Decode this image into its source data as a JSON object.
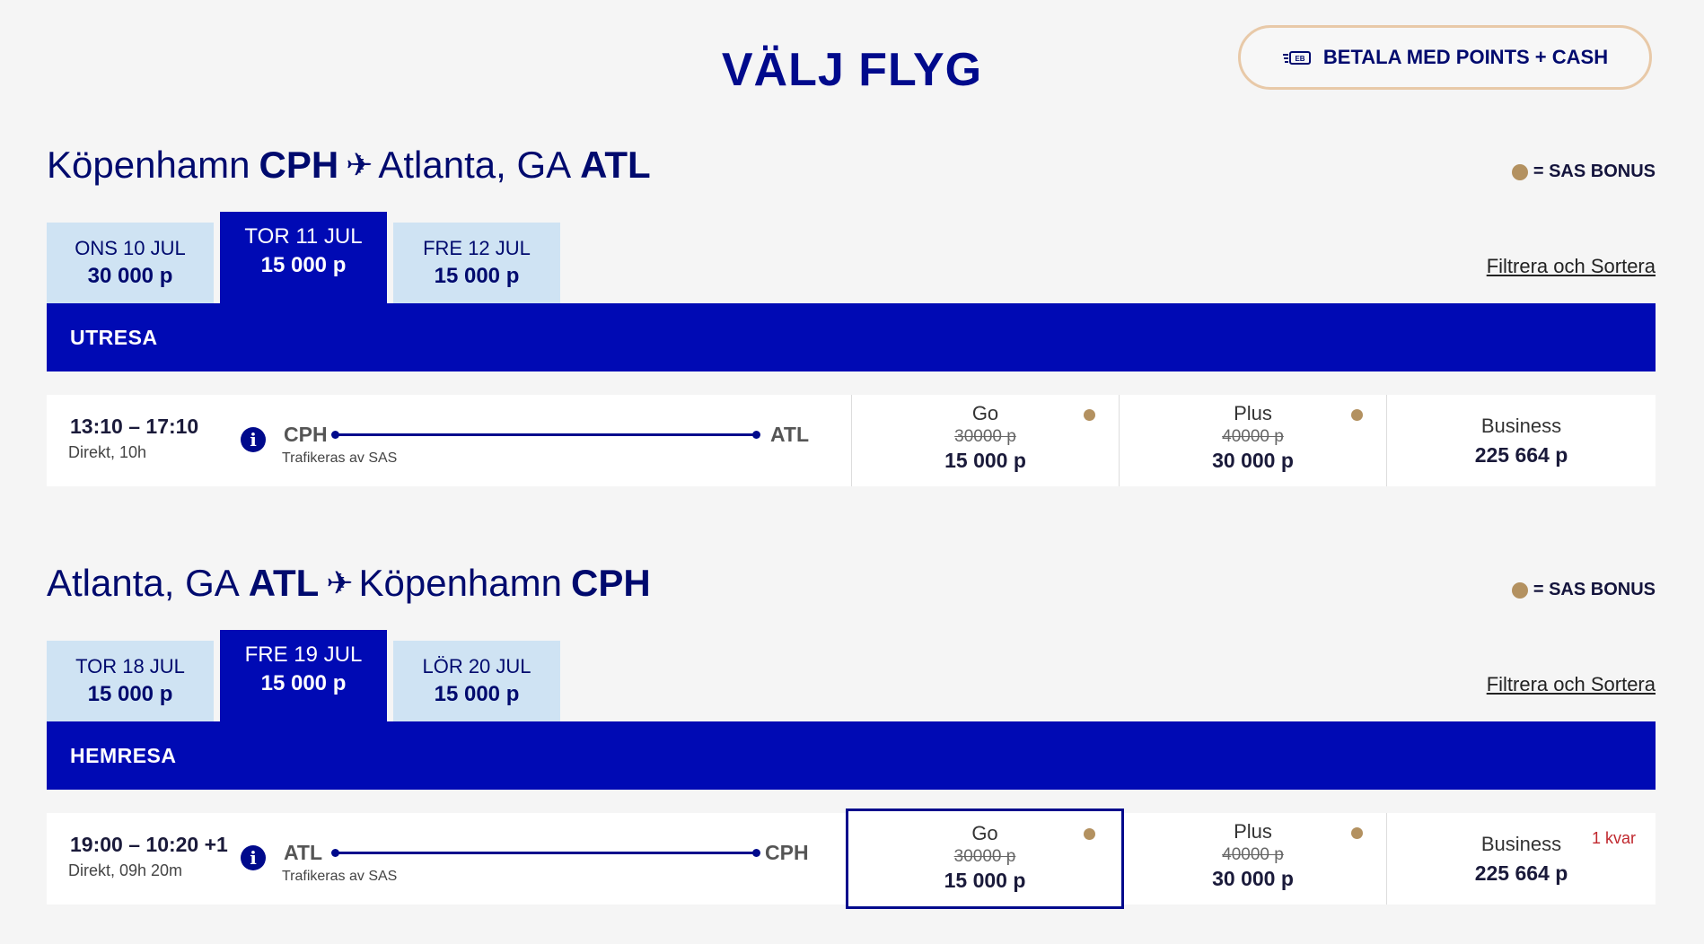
{
  "header": {
    "title": "VÄLJ FLYG",
    "points_cash_button": "BETALA MED POINTS + CASH"
  },
  "bonus_legend": "= SAS BONUS",
  "filter_link": "Filtrera och Sortera",
  "outbound": {
    "origin_city": "Köpenhamn",
    "origin_code": "CPH",
    "dest_city": "Atlanta, GA",
    "dest_code": "ATL",
    "dates": [
      {
        "day": "ONS 10 JUL",
        "points": "30 000 p"
      },
      {
        "day": "TOR 11 JUL",
        "points": "15 000 p"
      },
      {
        "day": "FRE 12 JUL",
        "points": "15 000 p"
      }
    ],
    "bar_label": "UTRESA",
    "flight": {
      "time": "13:10 – 17:10",
      "duration": "Direkt, 10h",
      "from": "CPH",
      "to": "ATL",
      "operated_by": "Trafikeras av SAS",
      "fares": [
        {
          "name": "Go",
          "old": "30000 p",
          "price": "15 000 p"
        },
        {
          "name": "Plus",
          "old": "40000 p",
          "price": "30 000 p"
        },
        {
          "name": "Business",
          "price": "225 664 p"
        }
      ]
    }
  },
  "return": {
    "origin_city": "Atlanta, GA",
    "origin_code": "ATL",
    "dest_city": "Köpenhamn",
    "dest_code": "CPH",
    "dates": [
      {
        "day": "TOR 18 JUL",
        "points": "15 000 p"
      },
      {
        "day": "FRE 19 JUL",
        "points": "15 000 p"
      },
      {
        "day": "LÖR 20 JUL",
        "points": "15 000 p"
      }
    ],
    "bar_label": "HEMRESA",
    "flight": {
      "time": "19:00 – 10:20 +1",
      "duration": "Direkt, 09h 20m",
      "from": "ATL",
      "to": "CPH",
      "operated_by": "Trafikeras av SAS",
      "fares": [
        {
          "name": "Go",
          "old": "30000 p",
          "price": "15 000 p"
        },
        {
          "name": "Plus",
          "old": "40000 p",
          "price": "30 000 p"
        },
        {
          "name": "Business",
          "price": "225 664 p",
          "seats_left": "1 kvar"
        }
      ]
    }
  },
  "colors": {
    "brand_blue": "#000ab4",
    "tab_light": "#cfe3f3",
    "bonus_gold": "#b39160",
    "accent_border": "#e8c9a8",
    "warning_red": "#c0272d"
  }
}
